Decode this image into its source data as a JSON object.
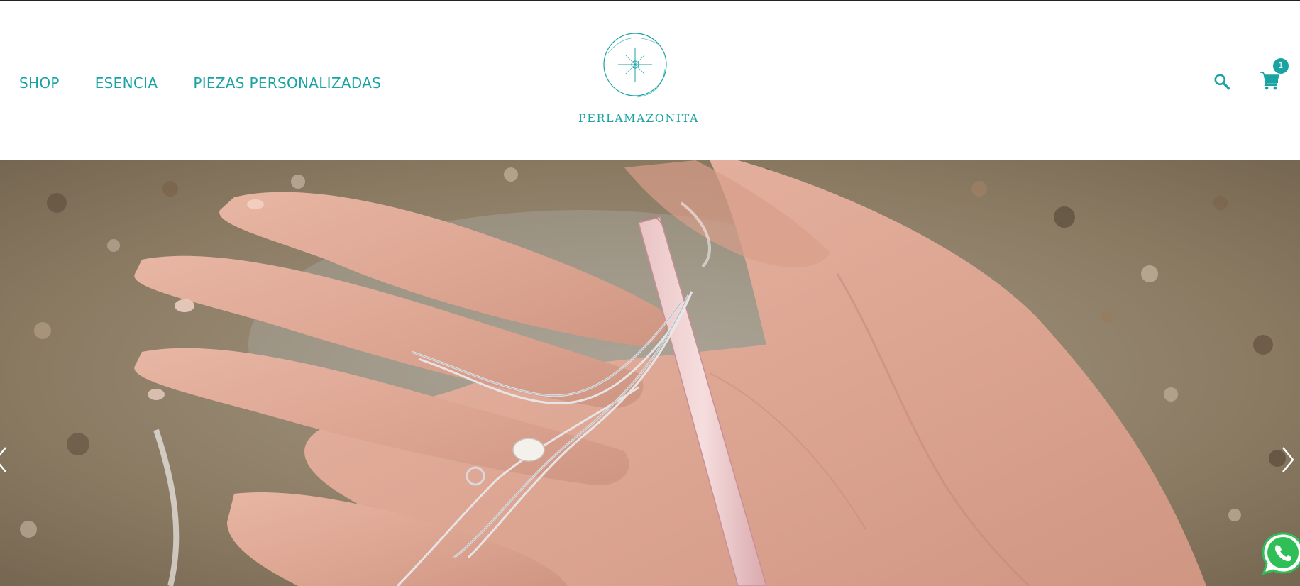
{
  "nav": {
    "items": [
      {
        "label": "SHOP"
      },
      {
        "label": "ESENCIA"
      },
      {
        "label": "PIEZAS PERSONALIZADAS"
      }
    ]
  },
  "logo": {
    "text": "PERLAMAZONITA",
    "icon": "compass-star-icon"
  },
  "header_actions": {
    "search_icon": "search-icon",
    "cart_icon": "cart-icon",
    "cart_count": "1"
  },
  "hero": {
    "image": "hand-holding-silver-chains-and-rose-quartz-crystal-on-wet-beach",
    "prev_icon": "chevron-left-icon",
    "next_icon": "chevron-right-icon"
  },
  "whatsapp": {
    "icon": "whatsapp-icon"
  },
  "colors": {
    "accent": "#1aa3a3",
    "background": "#ffffff"
  }
}
